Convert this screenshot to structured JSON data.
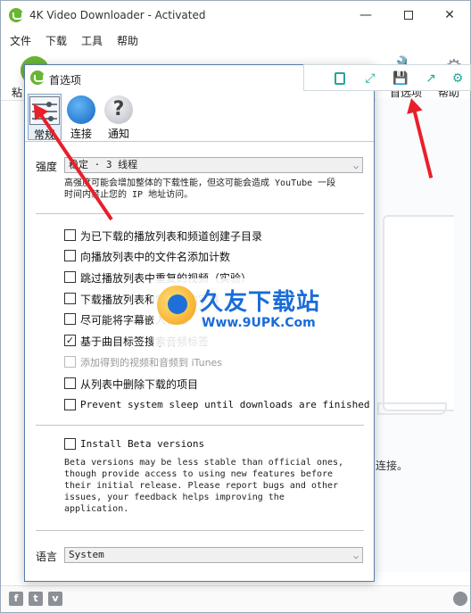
{
  "window": {
    "title": "4K Video Downloader - Activated"
  },
  "menu": [
    "文件",
    "下载",
    "工具",
    "帮助"
  ],
  "toolbar": {
    "paste_label": "粘",
    "preferences_label": "首选项",
    "help_label": "帮助"
  },
  "hint_text": "连接。",
  "dialog": {
    "title": "首选项",
    "tabs": [
      {
        "label": "常规",
        "icon": "sliders-icon",
        "active": true
      },
      {
        "label": "连接",
        "icon": "globe-icon"
      },
      {
        "label": "通知",
        "icon": "question-icon"
      }
    ],
    "intensity_label": "强度",
    "intensity_value": "稳定 · 3 线程",
    "intensity_desc_line1": "高强度可能会增加整体的下载性能，但这可能会造成 YouTube 一段",
    "intensity_desc_line2": "时间内禁止您的 IP 地址访问。",
    "options": [
      {
        "label": "为已下载的播放列表和频道创建子目录",
        "checked": false
      },
      {
        "label": "向播放列表中的文件名添加计数",
        "checked": false
      },
      {
        "label": "跳过播放列表中重复的视频（实验）",
        "checked": false
      },
      {
        "label": "下载播放列表和频道中的字幕",
        "checked": false
      },
      {
        "label": "尽可能将字幕嵌入视频",
        "checked": false
      },
      {
        "label": "基于曲目标签搜索音频标签",
        "checked": true
      },
      {
        "label": "添加得到的视频和音频到 iTunes",
        "checked": false,
        "disabled": true
      },
      {
        "label": "从列表中删除下载的项目",
        "checked": false
      },
      {
        "label": "Prevent system sleep until downloads are finished",
        "checked": false
      }
    ],
    "beta_label": "Install Beta versions",
    "beta_desc": [
      "Beta versions may be less stable than official ones,",
      "though provide access to using new features before",
      "their initial release. Please report bugs and other",
      "issues, your feedback helps improving the",
      "application."
    ],
    "language_label": "语言",
    "language_value": "System"
  },
  "watermark": {
    "text": "久友下载站",
    "url": "Www.9UPK.Com"
  },
  "colors": {
    "accent_green": "#6ab533",
    "tool_teal": "#26a69a",
    "arrow_red": "#e8202a",
    "watermark_blue": "#1a6cd8"
  }
}
